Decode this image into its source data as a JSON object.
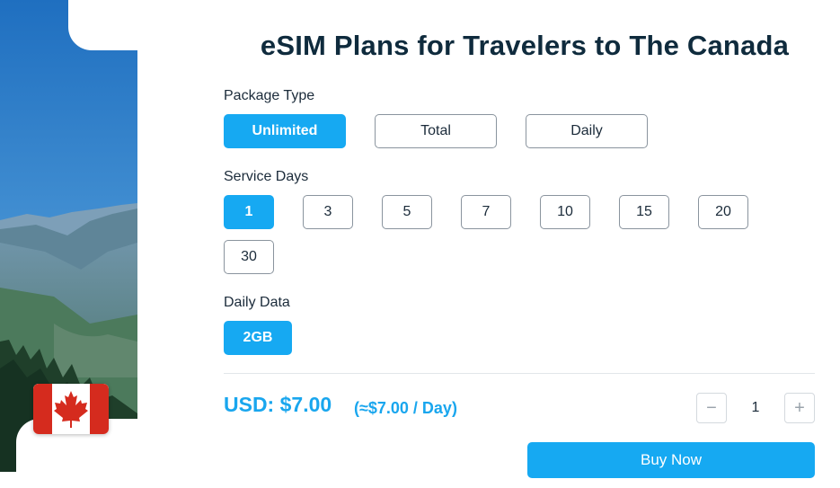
{
  "title": "eSIM Plans for Travelers to The Canada",
  "package_type": {
    "label": "Package Type",
    "options": [
      "Unlimited",
      "Total",
      "Daily"
    ],
    "selected": "Unlimited"
  },
  "service_days": {
    "label": "Service Days",
    "options": [
      "1",
      "3",
      "5",
      "7",
      "10",
      "15",
      "20",
      "30"
    ],
    "selected": "1"
  },
  "daily_data": {
    "label": "Daily Data",
    "options": [
      "2GB"
    ],
    "selected": "2GB"
  },
  "pricing": {
    "price": "USD: $7.00",
    "per_day": "(≈$7.00 / Day)"
  },
  "quantity": {
    "value": "1",
    "decrement_symbol": "−",
    "increment_symbol": "+"
  },
  "buy_label": "Buy Now",
  "flag": {
    "country": "Canada",
    "icon": "canada-flag-icon"
  },
  "colors": {
    "accent": "#16a9f2",
    "title": "#0f2b3d",
    "border": "#8a949e",
    "flag_red": "#d52b1e"
  }
}
